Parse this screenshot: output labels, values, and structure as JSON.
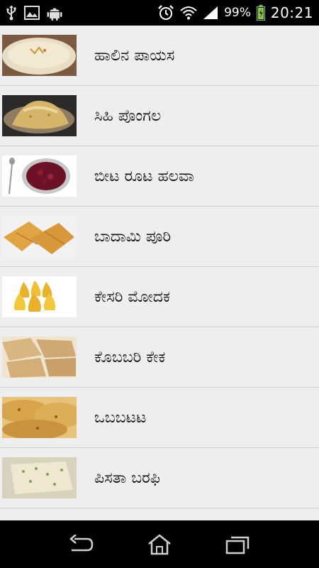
{
  "status_bar": {
    "icons_left": [
      "usb-icon",
      "image-icon",
      "android-icon"
    ],
    "icons_right": [
      "alarm-icon",
      "wifi-icon",
      "signal-icon",
      "battery-icon"
    ],
    "battery_percent": "99%",
    "time": "20:21"
  },
  "list": {
    "items": [
      {
        "label": "ಹಾಲಿನ ಪಾಯಸ",
        "image": "payasa-thumbnail"
      },
      {
        "label": "ಸಿಹಿ ಪೊಂಗಲ",
        "image": "pongal-thumbnail"
      },
      {
        "label": "ಬೀಟ ರೂಟ ಹಲವಾ",
        "image": "beetroot-halwa-thumbnail"
      },
      {
        "label": "ಬಾದಾಮಿ ಪೂರಿ",
        "image": "badami-puri-thumbnail"
      },
      {
        "label": "ಕೇಸರಿ ಮೋದಕ",
        "image": "kesari-modak-thumbnail"
      },
      {
        "label": "ಕೊಬಬರಿ ಕೇಕ",
        "image": "coconut-cake-thumbnail"
      },
      {
        "label": "ಒಬಬಟಟ",
        "image": "obbattu-thumbnail"
      },
      {
        "label": "ಪಿಸತಾ ಬರಫಿ",
        "image": "pista-barfi-thumbnail"
      }
    ]
  },
  "nav_bar": {
    "buttons": [
      "back-icon",
      "home-icon",
      "recent-apps-icon"
    ]
  },
  "colors": {
    "status_bar_bg": "#000000",
    "list_bg": "#eeeeee",
    "divider": "#d4d4d4",
    "battery_green": "#8bc34a"
  }
}
